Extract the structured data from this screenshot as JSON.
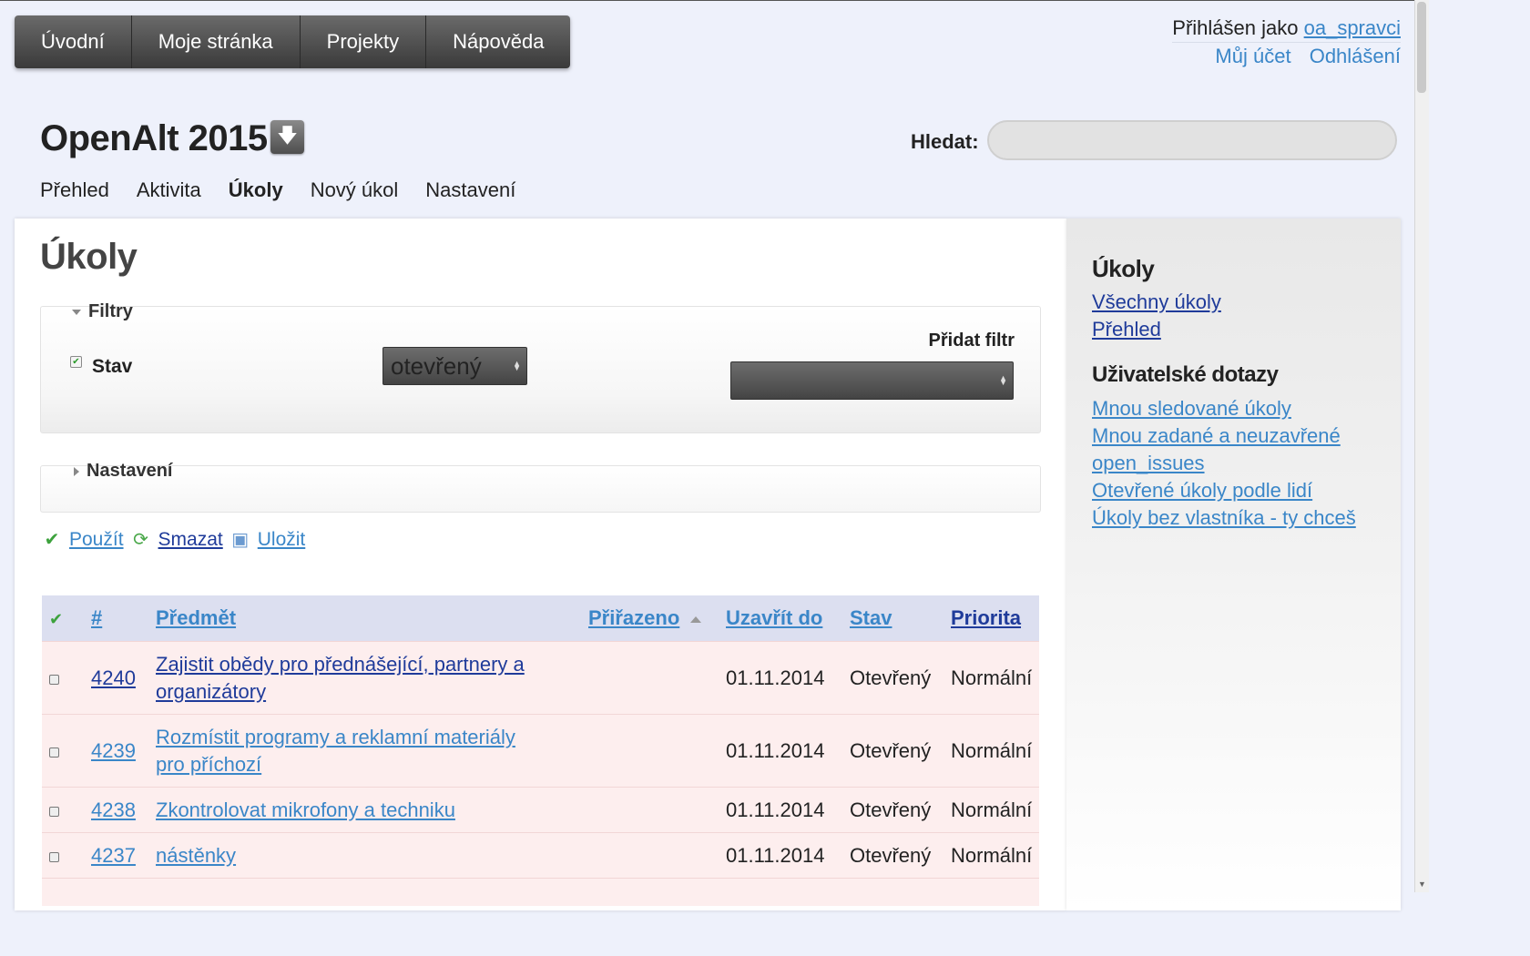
{
  "top_menu": [
    "Úvodní",
    "Moje stránka",
    "Projekty",
    "Nápověda"
  ],
  "account": {
    "logged_in_as": "Přihlášen jako",
    "username": "oa_spravci",
    "my_account": "Můj účet",
    "logout": "Odhlášení"
  },
  "project": {
    "title": "OpenAlt 2015",
    "button_icon": "arrow-down-icon"
  },
  "search": {
    "label": "Hledat:",
    "value": ""
  },
  "main_menu": [
    {
      "label": "Přehled",
      "selected": false
    },
    {
      "label": "Aktivita",
      "selected": false
    },
    {
      "label": "Úkoly",
      "selected": true
    },
    {
      "label": "Nový úkol",
      "selected": false
    },
    {
      "label": "Nastavení",
      "selected": false
    }
  ],
  "content": {
    "heading": "Úkoly",
    "filters": {
      "legend": "Filtry",
      "status_label": "Stav",
      "status_value": "otevřený",
      "add_filter_label": "Přidat filtr",
      "add_filter_value": ""
    },
    "options": {
      "legend": "Nastavení"
    },
    "actions": {
      "apply": "Použít",
      "clear": "Smazat",
      "save": "Uložit"
    },
    "table": {
      "headers": {
        "id": "#",
        "subject": "Předmět",
        "assigned": "Přiřazeno",
        "due": "Uzavřít do",
        "status": "Stav",
        "priority": "Priorita"
      },
      "rows": [
        {
          "id": "4240",
          "subject_line1": "Zajistit obědy pro přednášející, partnery a",
          "subject_line2": "organizátory",
          "assigned": "",
          "due": "01.11.2014",
          "status": "Otevřený",
          "priority": "Normální"
        },
        {
          "id": "4239",
          "subject_line1": "Rozmístit programy a reklamní materiály",
          "subject_line2": "pro příchozí",
          "assigned": "",
          "due": "01.11.2014",
          "status": "Otevřený",
          "priority": "Normální"
        },
        {
          "id": "4238",
          "subject_line1": "Zkontrolovat mikrofony a techniku",
          "subject_line2": "",
          "assigned": "",
          "due": "01.11.2014",
          "status": "Otevřený",
          "priority": "Normální"
        },
        {
          "id": "4237",
          "subject_line1": "nástěnky",
          "subject_line2": "",
          "assigned": "",
          "due": "01.11.2014",
          "status": "Otevřený",
          "priority": "Normální"
        }
      ]
    }
  },
  "sidebar": {
    "issues_heading": "Úkoly",
    "issues_links": [
      "Všechny úkoly",
      "Přehled"
    ],
    "queries_heading": "Uživatelské dotazy",
    "queries_links": [
      "Mnou sledované úkoly",
      "Mnou zadané a neuzavřené",
      "open_issues",
      "Otevřené úkoly podle lidí",
      "Úkoly bez vlastníka - ty chceš"
    ]
  },
  "colors": {
    "link": "#3a86c8",
    "visited_link": "#1f3b9a",
    "row_background": "#fdeeee",
    "table_header": "#dcdff0",
    "page_background": "#eef1fb"
  }
}
